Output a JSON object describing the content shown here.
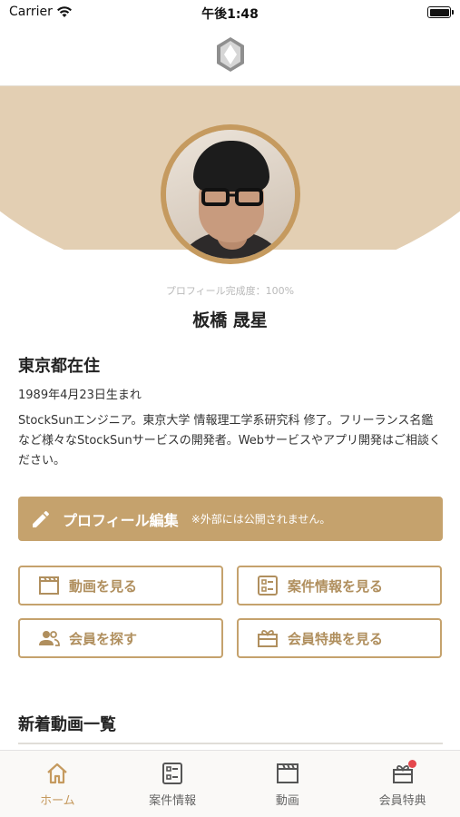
{
  "status_bar": {
    "carrier": "Carrier",
    "time": "午後1:48"
  },
  "profile": {
    "completion": "プロフィール完成度：100%",
    "name": "板橋 晟星",
    "location": "東京都在住",
    "birthday": "1989年4月23日生まれ",
    "bio": "StockSunエンジニア。東京大学 情報理工学系研究科 修了。フリーランス名鑑など様々なStockSunサービスの開発者。Webサービスやアプリ開発はご相談ください。"
  },
  "edit_profile": {
    "label": "プロフィール編集",
    "note": "※外部には公開されません。"
  },
  "actions": {
    "videos": "動画を見る",
    "projects": "案件情報を見る",
    "members": "会員を探す",
    "perks": "会員特典を見る"
  },
  "section": {
    "title": "新着動画一覧"
  },
  "tabs": [
    {
      "label": "ホーム",
      "icon": "home-icon",
      "active": true
    },
    {
      "label": "案件情報",
      "icon": "list-card-icon",
      "active": false
    },
    {
      "label": "動画",
      "icon": "clapperboard-icon",
      "active": false
    },
    {
      "label": "会員特典",
      "icon": "gift-icon",
      "active": false,
      "badge": true
    }
  ],
  "colors": {
    "accent": "#c5a26d",
    "header_arc": "#e3cfb3",
    "badge": "#e5484d"
  }
}
